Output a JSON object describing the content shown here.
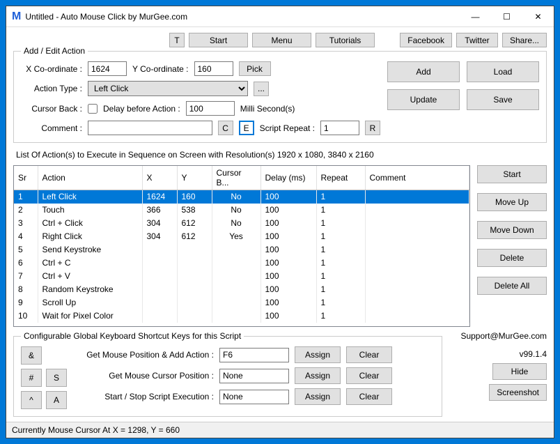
{
  "window": {
    "title": "Untitled - Auto Mouse Click by MurGee.com"
  },
  "topbar": {
    "t": "T",
    "start": "Start",
    "menu": "Menu",
    "tutorials": "Tutorials",
    "facebook": "Facebook",
    "twitter": "Twitter",
    "share": "Share..."
  },
  "form": {
    "legend": "Add / Edit Action",
    "xlabel": "X Co-ordinate :",
    "xval": "1624",
    "ylabel": "Y Co-ordinate :",
    "yval": "160",
    "pick": "Pick",
    "typelabel": "Action Type :",
    "typeval": "Left Click",
    "dots": "...",
    "cursorback": "Cursor Back :",
    "delaylabel": "Delay before Action :",
    "delayval": "100",
    "delayunit": "Milli Second(s)",
    "commentlabel": "Comment :",
    "commentval": "",
    "c": "C",
    "e": "E",
    "repeatlabel": "Script Repeat :",
    "repeatval": "1",
    "r": "R",
    "add": "Add",
    "load": "Load",
    "update": "Update",
    "save": "Save"
  },
  "list": {
    "label": "List Of Action(s) to Execute in Sequence on Screen with Resolution(s) 1920 x 1080, 3840 x 2160",
    "headers": {
      "sr": "Sr",
      "action": "Action",
      "x": "X",
      "y": "Y",
      "cursor": "Cursor B...",
      "delay": "Delay (ms)",
      "repeat": "Repeat",
      "comment": "Comment"
    },
    "rows": [
      {
        "sr": "1",
        "action": "Left Click",
        "x": "1624",
        "y": "160",
        "cursor": "No",
        "delay": "100",
        "repeat": "1",
        "comment": ""
      },
      {
        "sr": "2",
        "action": "Touch",
        "x": "366",
        "y": "538",
        "cursor": "No",
        "delay": "100",
        "repeat": "1",
        "comment": ""
      },
      {
        "sr": "3",
        "action": "Ctrl + Click",
        "x": "304",
        "y": "612",
        "cursor": "No",
        "delay": "100",
        "repeat": "1",
        "comment": ""
      },
      {
        "sr": "4",
        "action": "Right Click",
        "x": "304",
        "y": "612",
        "cursor": "Yes",
        "delay": "100",
        "repeat": "1",
        "comment": ""
      },
      {
        "sr": "5",
        "action": "Send Keystroke",
        "x": "",
        "y": "",
        "cursor": "",
        "delay": "100",
        "repeat": "1",
        "comment": ""
      },
      {
        "sr": "6",
        "action": "Ctrl + C",
        "x": "",
        "y": "",
        "cursor": "",
        "delay": "100",
        "repeat": "1",
        "comment": ""
      },
      {
        "sr": "7",
        "action": "Ctrl + V",
        "x": "",
        "y": "",
        "cursor": "",
        "delay": "100",
        "repeat": "1",
        "comment": ""
      },
      {
        "sr": "8",
        "action": "Random Keystroke",
        "x": "",
        "y": "",
        "cursor": "",
        "delay": "100",
        "repeat": "1",
        "comment": ""
      },
      {
        "sr": "9",
        "action": "Scroll Up",
        "x": "",
        "y": "",
        "cursor": "",
        "delay": "100",
        "repeat": "1",
        "comment": ""
      },
      {
        "sr": "10",
        "action": "Wait for Pixel Color",
        "x": "",
        "y": "",
        "cursor": "",
        "delay": "100",
        "repeat": "1",
        "comment": ""
      }
    ],
    "btns": {
      "start": "Start",
      "moveup": "Move Up",
      "movedown": "Move Down",
      "delete": "Delete",
      "deleteall": "Delete All"
    }
  },
  "shortcuts": {
    "legend": "Configurable Global Keyboard Shortcut Keys for this Script",
    "amp": "&",
    "hash": "#",
    "s": "S",
    "caret": "^",
    "a": "A",
    "getposadd": "Get Mouse Position & Add Action :",
    "getposadd_val": "F6",
    "getpos": "Get Mouse Cursor Position :",
    "getpos_val": "None",
    "startstop": "Start / Stop Script Execution :",
    "startstop_val": "None",
    "assign": "Assign",
    "clear": "Clear"
  },
  "side": {
    "support": "Support@MurGee.com",
    "version": "v99.1.4",
    "hide": "Hide",
    "screenshot": "Screenshot"
  },
  "status": "Currently Mouse Cursor At X = 1298, Y = 660"
}
